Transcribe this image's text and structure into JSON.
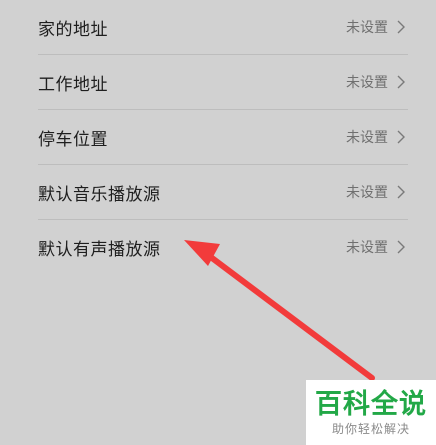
{
  "settings": {
    "items": [
      {
        "label": "家的地址",
        "value": "未设置"
      },
      {
        "label": "工作地址",
        "value": "未设置"
      },
      {
        "label": "停车位置",
        "value": "未设置"
      },
      {
        "label": "默认音乐播放源",
        "value": "未设置"
      },
      {
        "label": "默认有声播放源",
        "value": "未设置"
      }
    ]
  },
  "annotation": {
    "arrow_color": "#f23b3b",
    "arrow_icon": "red-arrow-pointer"
  },
  "watermark": {
    "title": "百科全说",
    "subtitle": "助你轻松解决",
    "title_color": "#22a847"
  },
  "colors": {
    "background": "#d1d1d1",
    "divider": "#bdbdbd",
    "label": "#1e1e1e",
    "value": "#6f6f6f"
  }
}
